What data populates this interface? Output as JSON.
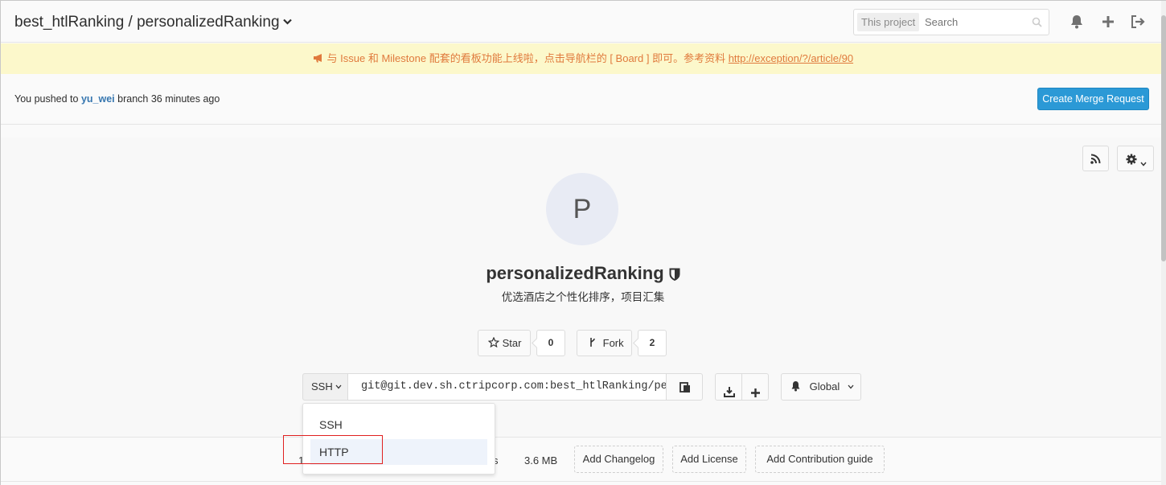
{
  "header": {
    "title": "best_htlRanking / personalizedRanking",
    "search_scope": "This project",
    "search_placeholder": "Search"
  },
  "broadcast": {
    "icon": "megaphone-icon",
    "text": "与 Issue 和 Milestone 配套的看板功能上线啦，点击导航栏的 [ Board ] 即可。参考资料",
    "link": "http://exception/?/article/90",
    "color": "#e07a3d"
  },
  "push_notice": {
    "prefix": "You pushed to",
    "branch": "yu_wei",
    "suffix": "branch 36 minutes ago",
    "button": "Create Merge Request"
  },
  "project": {
    "avatar_letter": "P",
    "name": "personalizedRanking",
    "description": "优选酒店之个性化排序，项目汇集",
    "star_label": "Star",
    "star_count": "0",
    "fork_label": "Fork",
    "fork_count": "2"
  },
  "clone": {
    "protocol": "SSH",
    "url": "git@git.dev.sh.ctripcorp.com:best_htlRanking/personalizedRanking.git",
    "notification_label": "Global",
    "dropdown_options": [
      "SSH",
      "HTTP"
    ],
    "highlighted_option": "HTTP"
  },
  "stats": {
    "partial_left": "1",
    "partial_right": "s",
    "size": "3.6 MB",
    "add_changelog": "Add Changelog",
    "add_license": "Add License",
    "add_contribution": "Add Contribution guide"
  },
  "colors": {
    "accent_button": "#2b99d6",
    "branch_link": "#3777b0",
    "broadcast_bg": "#fcf8cb",
    "highlight_box": "#e02020"
  }
}
